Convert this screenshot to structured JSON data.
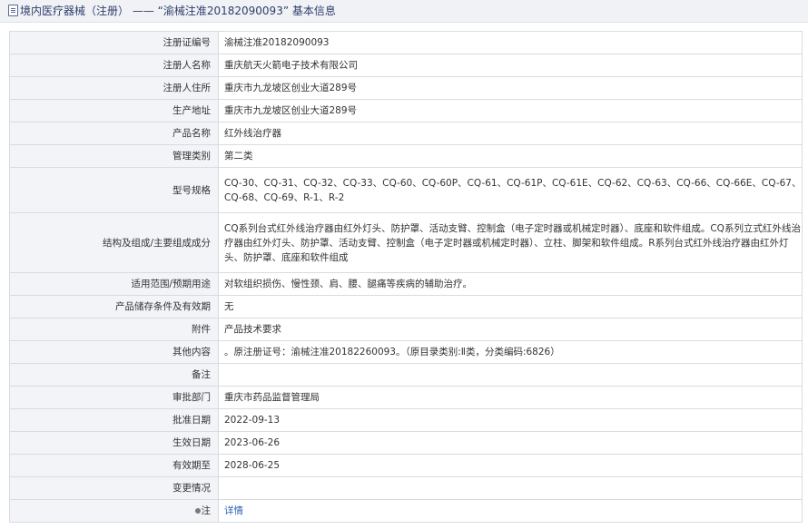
{
  "header": {
    "title": "境内医疗器械（注册） —— “渝械注准20182090093” 基本信息"
  },
  "rows": [
    {
      "label": "注册证编号",
      "value": "渝械注准20182090093"
    },
    {
      "label": "注册人名称",
      "value": "重庆航天火箭电子技术有限公司"
    },
    {
      "label": "注册人住所",
      "value": "重庆市九龙坡区创业大道289号"
    },
    {
      "label": "生产地址",
      "value": "重庆市九龙坡区创业大道289号"
    },
    {
      "label": "产品名称",
      "value": "红外线治疗器"
    },
    {
      "label": "管理类别",
      "value": "第二类"
    },
    {
      "label": "型号规格",
      "value": "CQ-30、CQ-31、CQ-32、CQ-33、CQ-60、CQ-60P、CQ-61、CQ-61P、CQ-61E、CQ-62、CQ-63、CQ-66、CQ-66E、CQ-67、CQ-68、CQ-69、R-1、R-2"
    },
    {
      "label": "结构及组成/主要组成成分",
      "value": "CQ系列台式红外线治疗器由红外灯头、防护罩、活动支臂、控制盒（电子定时器或机械定时器）、底座和软件组成。CQ系列立式红外线治疗器由红外灯头、防护罩、活动支臂、控制盒（电子定时器或机械定时器）、立柱、脚架和软件组成。R系列台式红外线治疗器由红外灯头、防护罩、底座和软件组成"
    },
    {
      "label": "适用范围/预期用途",
      "value": "对软组织损伤、慢性颈、肩、腰、腿痛等疾病的辅助治疗。"
    },
    {
      "label": "产品储存条件及有效期",
      "value": "无"
    },
    {
      "label": "附件",
      "value": "产品技术要求"
    },
    {
      "label": "其他内容",
      "value": "。原注册证号：渝械注准20182260093。（原目录类别:Ⅱ类，分类编码:6826）"
    },
    {
      "label": "备注",
      "value": ""
    },
    {
      "label": "审批部门",
      "value": "重庆市药品监督管理局"
    },
    {
      "label": "批准日期",
      "value": "2022-09-13"
    },
    {
      "label": "生效日期",
      "value": "2023-06-26"
    },
    {
      "label": "有效期至",
      "value": "2028-06-25"
    },
    {
      "label": "变更情况",
      "value": ""
    },
    {
      "label": "注",
      "value": "详情"
    }
  ]
}
